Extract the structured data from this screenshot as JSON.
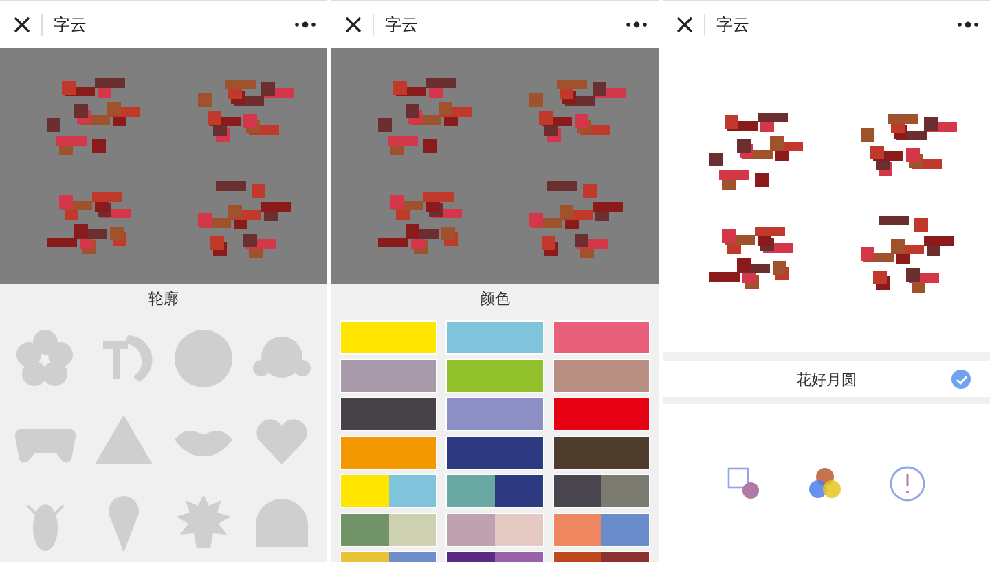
{
  "panels": [
    {
      "kind": "outline",
      "header": {
        "title": "字云"
      },
      "section_label": "轮廓"
    },
    {
      "kind": "colors",
      "header": {
        "title": "字云"
      },
      "section_label": "颜色",
      "palettes": [
        {
          "parts": [
            {
              "color": "#ffe600"
            }
          ]
        },
        {
          "parts": [
            {
              "color": "#7fc4da"
            }
          ]
        },
        {
          "parts": [
            {
              "color": "#e8607a"
            }
          ]
        },
        {
          "parts": [
            {
              "color": "#a99aaa"
            }
          ]
        },
        {
          "parts": [
            {
              "color": "#92c02a"
            }
          ]
        },
        {
          "parts": [
            {
              "color": "#b88f82"
            }
          ]
        },
        {
          "parts": [
            {
              "color": "#474248"
            }
          ]
        },
        {
          "parts": [
            {
              "color": "#8b8fc6"
            }
          ]
        },
        {
          "parts": [
            {
              "color": "#e60012"
            }
          ]
        },
        {
          "parts": [
            {
              "color": "#f39800"
            }
          ]
        },
        {
          "parts": [
            {
              "color": "#2d3a82"
            }
          ]
        },
        {
          "parts": [
            {
              "color": "#4e3d2c"
            }
          ]
        },
        {
          "parts": [
            {
              "color": "#ffe600"
            },
            {
              "color": "#7fc4da"
            }
          ]
        },
        {
          "parts": [
            {
              "color": "#6aa8a4"
            },
            {
              "color": "#2d3a82"
            }
          ]
        },
        {
          "parts": [
            {
              "color": "#49454c"
            },
            {
              "color": "#7b7b72"
            }
          ]
        },
        {
          "parts": [
            {
              "color": "#729367"
            },
            {
              "color": "#cdd1b2"
            }
          ]
        },
        {
          "parts": [
            {
              "color": "#bea2b0"
            },
            {
              "color": "#e5cac4"
            }
          ]
        },
        {
          "parts": [
            {
              "color": "#ee8660"
            },
            {
              "color": "#6b8ccb"
            }
          ]
        },
        {
          "parts": [
            {
              "color": "#e9c337"
            },
            {
              "color": "#6f8fcc"
            }
          ]
        },
        {
          "parts": [
            {
              "color": "#5a2a84"
            },
            {
              "color": "#9a62aa"
            }
          ]
        },
        {
          "parts": [
            {
              "color": "#c0461e"
            },
            {
              "color": "#8b2f2f"
            }
          ]
        }
      ]
    },
    {
      "kind": "result",
      "header": {
        "title": "字云"
      },
      "text_item": {
        "label": "花好月圆",
        "checked": true
      }
    }
  ]
}
